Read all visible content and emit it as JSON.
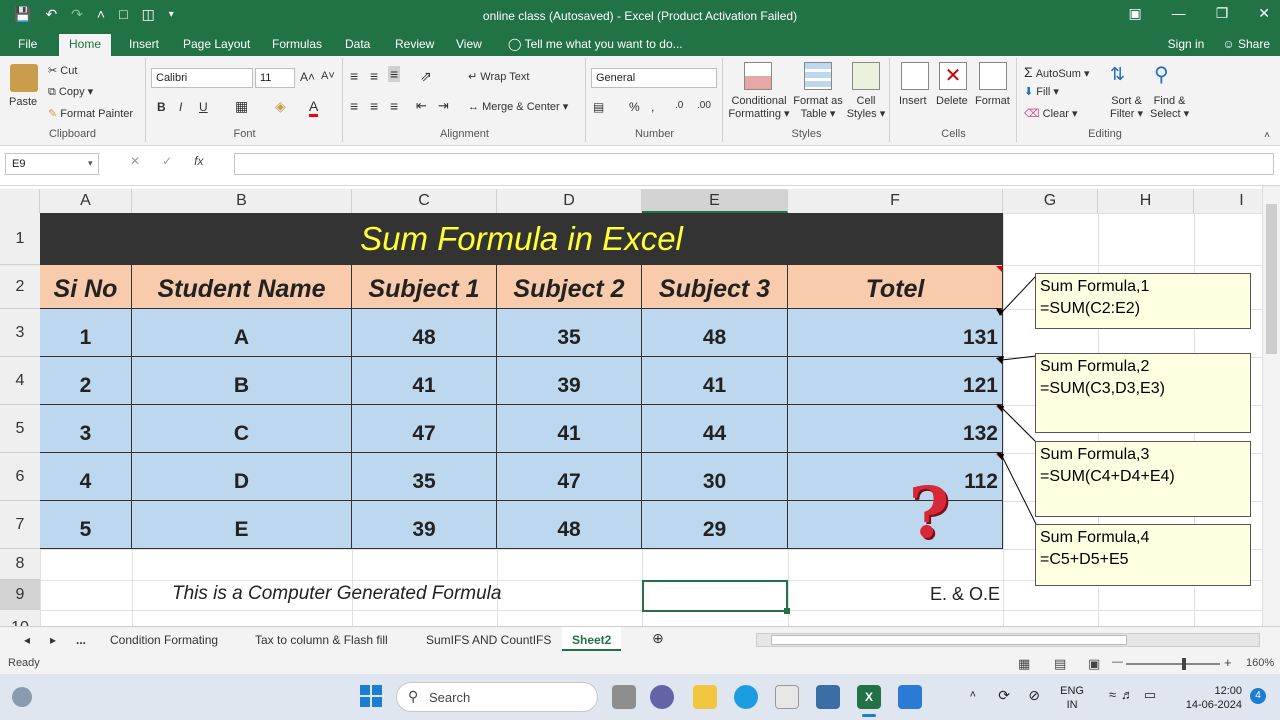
{
  "titlebar": {
    "title": "online class (Autosaved) - Excel (Product Activation Failed)"
  },
  "menu": {
    "tabs": [
      "File",
      "Home",
      "Insert",
      "Page Layout",
      "Formulas",
      "Data",
      "Review",
      "View"
    ],
    "tell_me": "Tell me what you want to do...",
    "sign_in": "Sign in",
    "share": "Share"
  },
  "ribbon": {
    "clipboard": {
      "paste": "Paste",
      "cut": "Cut",
      "copy": "Copy",
      "format_painter": "Format Painter",
      "label": "Clipboard"
    },
    "font": {
      "name": "Calibri",
      "size": "11",
      "label": "Font"
    },
    "alignment": {
      "wrap_text": "Wrap Text",
      "merge_center": "Merge & Center",
      "label": "Alignment"
    },
    "number": {
      "format": "General",
      "label": "Number"
    },
    "styles": {
      "conditional": "Conditional",
      "conditional2": "Formatting",
      "format_as": "Format as",
      "format_as2": "Table",
      "cell": "Cell",
      "cell2": "Styles",
      "label": "Styles"
    },
    "cells": {
      "insert": "Insert",
      "delete": "Delete",
      "format": "Format",
      "label": "Cells"
    },
    "editing": {
      "autosum": "AutoSum",
      "fill": "Fill",
      "clear": "Clear",
      "sort": "Sort &",
      "sort2": "Filter",
      "find": "Find &",
      "find2": "Select",
      "label": "Editing"
    }
  },
  "formula_bar": {
    "name_box": "E9",
    "content": ""
  },
  "columns": [
    "A",
    "B",
    "C",
    "D",
    "E",
    "F",
    "G",
    "H",
    "I"
  ],
  "rows": [
    "1",
    "2",
    "3",
    "4",
    "5",
    "6",
    "7",
    "8",
    "9",
    "10"
  ],
  "sheet": {
    "title": "Sum Formula in Excel",
    "headers": [
      "Si No",
      "Student Name",
      "Subject 1",
      "Subject 2",
      "Subject 3",
      "Totel"
    ],
    "data": [
      [
        "1",
        "A",
        "48",
        "35",
        "48",
        "131"
      ],
      [
        "2",
        "B",
        "41",
        "39",
        "41",
        "121"
      ],
      [
        "3",
        "C",
        "47",
        "41",
        "44",
        "132"
      ],
      [
        "4",
        "D",
        "35",
        "47",
        "30",
        "112"
      ],
      [
        "5",
        "E",
        "39",
        "48",
        "29",
        ""
      ]
    ],
    "footer_left": "This is a Computer Generated Formula",
    "footer_right": "E. & O.E",
    "question_mark": "?"
  },
  "comments": [
    {
      "line1": "Sum Formula,1",
      "line2": "=SUM(C2:E2)"
    },
    {
      "line1": "Sum Formula,2",
      "line2": "=SUM(C3,D3,E3)"
    },
    {
      "line1": "Sum Formula,3",
      "line2": "=SUM(C4+D4+E4)"
    },
    {
      "line1": "Sum Formula,4",
      "line2": "=C5+D5+E5"
    }
  ],
  "sheet_tabs": [
    "...",
    "Condition Formating",
    "Tax to column & Flash fill",
    "SumIFS AND CountIFS",
    "Sheet2"
  ],
  "status": {
    "ready": "Ready",
    "zoom": "160%"
  },
  "taskbar": {
    "search": "Search",
    "lang1": "ENG",
    "lang2": "IN",
    "time": "12:00",
    "date": "14-06-2024",
    "badge": "4"
  },
  "colors": {
    "excel_green": "#217346",
    "title_bg": "#333333",
    "title_text": "#ffff33",
    "header_bg": "#f8cbad",
    "data_bg": "#bdd7ee",
    "comment_bg": "#ffffe1"
  }
}
